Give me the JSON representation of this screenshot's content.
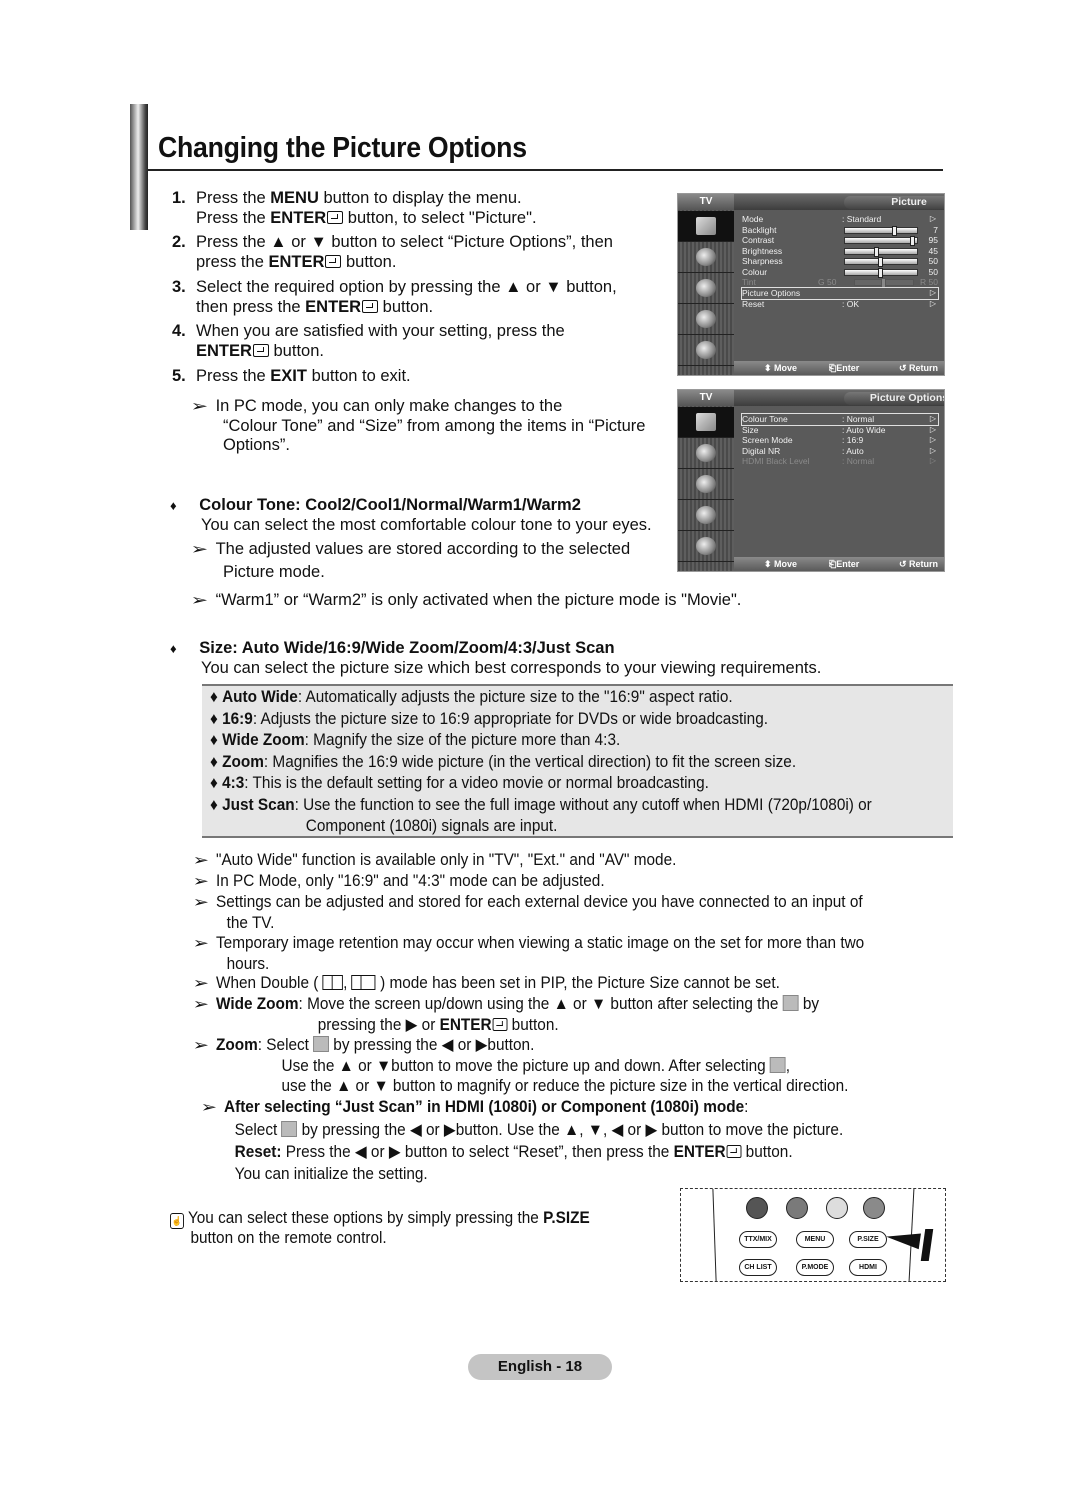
{
  "page": {
    "title": "Changing the Picture Options",
    "footer": "English - 18"
  },
  "steps": [
    {
      "num": "1.",
      "line1_a": "Press the ",
      "line1_b": "MENU",
      "line1_c": " button to display the menu.",
      "line2_a": "Press the ",
      "line2_b": "ENTER",
      "line2_c": " button, to select \"Picture\"."
    },
    {
      "num": "2.",
      "line1": "Press the ▲ or ▼ button to select “Picture Options”, then",
      "line2_a": "press the ",
      "line2_b": "ENTER",
      "line2_c": " button."
    },
    {
      "num": "3.",
      "line1": "Select the required option by pressing the ▲ or ▼ button,",
      "line2_a": "then press the ",
      "line2_b": "ENTER",
      "line2_c": " button."
    },
    {
      "num": "4.",
      "line1": "When you are satisfied with your setting, press the",
      "line2_b": "ENTER",
      "line2_c": " button."
    },
    {
      "num": "5.",
      "line1_a": "Press the ",
      "line1_b": "EXIT",
      "line1_c": " button to exit."
    }
  ],
  "pc_note": [
    "In PC mode, you can only make changes to the",
    "“Colour Tone” and “Size” from among the items in “Picture",
    "Options”."
  ],
  "colour_tone": {
    "heading": "Colour Tone: Cool2/Cool1/Normal/Warm1/Warm2",
    "desc": "You can select the most comfortable colour tone to your eyes.",
    "note1": [
      "The adjusted values are stored according to the selected",
      "Picture mode."
    ],
    "note2": "“Warm1” or “Warm2” is only activated when the picture mode is \"Movie\"."
  },
  "size": {
    "heading": "Size: Auto Wide/16:9/Wide Zoom/Zoom/4:3/Just Scan",
    "desc": "You can select the picture size which best corresponds to your viewing requirements.",
    "items": [
      {
        "term": "Auto Wide",
        "text": ": Automatically adjusts the picture size to the \"16:9\" aspect ratio."
      },
      {
        "term": "16:9",
        "text": ": Adjusts the picture size to 16:9 appropriate for DVDs or wide broadcasting."
      },
      {
        "term": "Wide Zoom",
        "text": ": Magnify the size of the picture more than 4:3."
      },
      {
        "term": "Zoom",
        "text": ": Magnifies the 16:9 wide picture (in the vertical direction) to fit the screen size."
      },
      {
        "term": "4:3",
        "text": ": This is the default setting for a video movie or normal broadcasting."
      },
      {
        "term": "Just Scan",
        "text": ": Use the function to see the full image without any cutoff when HDMI (720p/1080i) or",
        "text2": "Component (1080i) signals are input."
      }
    ],
    "notes": [
      "\"Auto Wide\" function is available only in \"TV\", \"Ext.\" and \"AV\" mode.",
      "In PC Mode, only \"16:9\" and \"4:3\" mode can be adjusted.",
      "Settings can be adjusted and stored for each external device you have connected to an input of",
      "the TV.",
      "Temporary image retention may occur when viewing a static image on the set for more than two",
      "hours."
    ],
    "double_note_a": "When Double (",
    "double_note_b": ",",
    "double_note_c": ") mode has been set in PIP, the Picture Size cannot be set.",
    "wide_zoom_term": "Wide Zoom",
    "wide_zoom_a": ": Move the screen up/down using the ▲ or ▼ button after selecting the",
    "wide_zoom_b": "by",
    "wide_zoom_c": "pressing the ▶ or ",
    "wide_zoom_enter": "ENTER",
    "wide_zoom_d": " button.",
    "zoom_term": "Zoom",
    "zoom_a": ": Select",
    "zoom_b": "by pressing the ◀ or ▶button.",
    "zoom_c": "Use the ▲ or ▼button to move the picture up and down. After selecting",
    "zoom_c2": ",",
    "zoom_d": "use the ▲ or ▼ button to magnify or reduce the picture size in the vertical direction.",
    "just_scan_heading": "After selecting “Just Scan” in HDMI (1080i) or Component (1080i) mode",
    "just_scan_colon": ":",
    "just_scan_a": "Select",
    "just_scan_b": "by pressing the ◀ or ▶button. Use the ▲, ▼, ◀ or ▶ button to move the picture.",
    "reset_term": "Reset:",
    "reset_a": " Press the ◀ or ▶ button to select “Reset”, then press the ",
    "reset_enter": "ENTER",
    "reset_b": " button.",
    "reset_c": "You can initialize the setting."
  },
  "psize_note": {
    "a": "You can select these options by simply pressing the ",
    "b": "P.SIZE",
    "c": "button on the remote control."
  },
  "osd_picture": {
    "tv_label": "TV",
    "title": "Picture",
    "rows": [
      {
        "label": "Mode",
        "value": ": Standard",
        "arrow": "▷"
      },
      {
        "label": "Backlight",
        "slider": 7,
        "max": 10,
        "num": "7"
      },
      {
        "label": "Contrast",
        "slider": 95,
        "max": 100,
        "num": "95"
      },
      {
        "label": "Brightness",
        "slider": 45,
        "max": 100,
        "num": "45"
      },
      {
        "label": "Sharpness",
        "slider": 50,
        "max": 100,
        "num": "50"
      },
      {
        "label": "Colour",
        "slider": 50,
        "max": 100,
        "num": "50"
      },
      {
        "label": "Tint",
        "g": "G 50",
        "r": "R 50",
        "slider": 50,
        "max": 100
      },
      {
        "label": "Picture Options",
        "arrow": "▷"
      },
      {
        "label": "Reset",
        "value": ": OK",
        "arrow": "▷"
      }
    ],
    "footer": {
      "move": "⬍ Move",
      "enter": "Enter",
      "return": "↺ Return"
    }
  },
  "osd_options": {
    "tv_label": "TV",
    "title": "Picture Options",
    "rows": [
      {
        "label": "Colour Tone",
        "value": ": Normal",
        "arrow": "▷"
      },
      {
        "label": "Size",
        "value": ": Auto Wide",
        "arrow": "▷"
      },
      {
        "label": "Screen Mode",
        "value": ": 16:9",
        "arrow": "▷"
      },
      {
        "label": "Digital NR",
        "value": ": Auto",
        "arrow": "▷"
      },
      {
        "label": "HDMI Black Level",
        "value": ": Normal",
        "arrow": "▷"
      }
    ],
    "footer": {
      "move": "⬍ Move",
      "enter": "Enter",
      "return": "↺ Return"
    }
  },
  "remote": {
    "colors": [
      "#555555",
      "#7a7a7a",
      "#dddddd",
      "#8a8a8a"
    ],
    "buttons": [
      "TTX/MIX",
      "MENU",
      "P.SIZE",
      "CH LIST",
      "P.MODE",
      "HDMI"
    ]
  }
}
